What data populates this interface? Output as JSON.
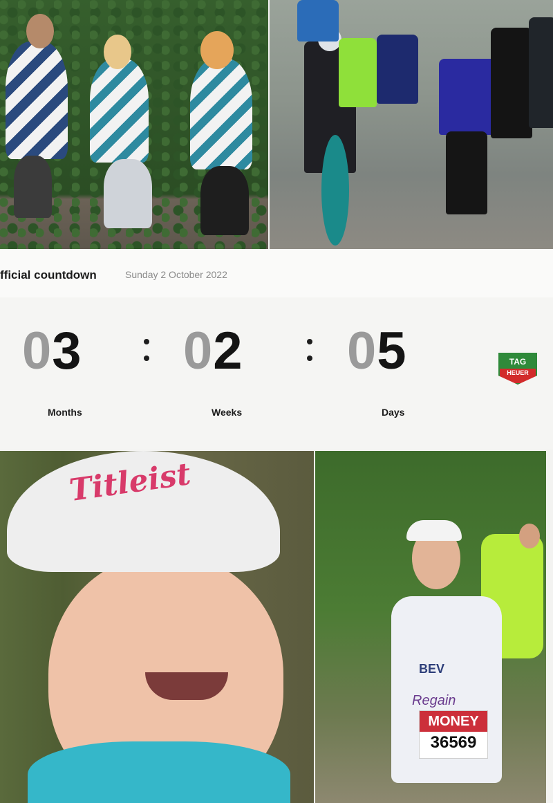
{
  "countdown": {
    "title": "fficial countdown",
    "date": "Sunday 2 October 2022",
    "months": {
      "value": "03",
      "dim": "0",
      "strong": "3",
      "label": "Months"
    },
    "weeks": {
      "value": "02",
      "dim": "0",
      "strong": "2",
      "label": "Weeks"
    },
    "days": {
      "value": "05",
      "dim": "0",
      "strong": "5",
      "label": "Days"
    }
  },
  "sponsor_logo": {
    "top": "TAG",
    "bottom": "HEUER"
  },
  "photos": {
    "portrait": {
      "cap_brand": "Titleist"
    },
    "marathon": {
      "bib_name": "BEV",
      "charity": "Regain",
      "bib_sponsor": "MONEY",
      "bib_number": "36569"
    }
  },
  "colors": {
    "accent_red": "#d22b2b",
    "accent_green": "#2f8a3a",
    "digit_dim": "#9a9a9a",
    "digit_strong": "#141414"
  }
}
